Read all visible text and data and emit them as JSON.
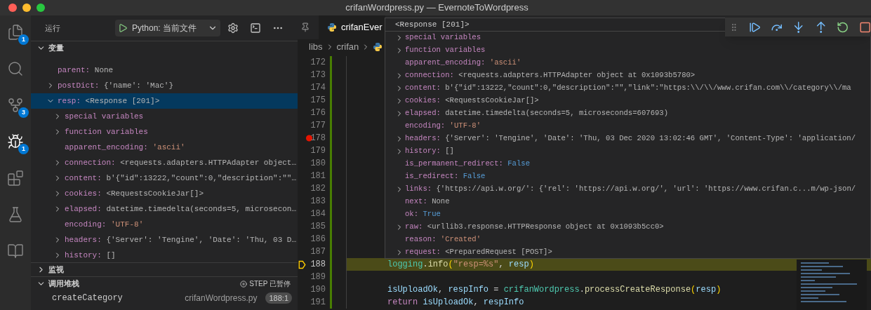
{
  "window": {
    "title": "crifanWordpress.py — EvernoteToWordpress"
  },
  "activity_bar": [
    {
      "kind": "files",
      "badge": "1",
      "selected": false
    },
    {
      "kind": "search",
      "selected": false
    },
    {
      "kind": "source-control",
      "badge": "3",
      "selected": false
    },
    {
      "kind": "debug",
      "badge": "1",
      "selected": true
    },
    {
      "kind": "extensions",
      "selected": false
    },
    {
      "kind": "testing",
      "selected": false
    },
    {
      "kind": "book",
      "selected": false
    }
  ],
  "run_header": {
    "title": "运行",
    "configuration": "Python: 当前文件"
  },
  "variables": {
    "title": "变量",
    "expanded": true,
    "items": [
      {
        "name": "parent:",
        "value": "None",
        "kind": "plain",
        "selected": false
      },
      {
        "name": "postDict:",
        "value": "{'name': 'Mac'}",
        "kind": "plain",
        "expanded": false,
        "selected": false
      },
      {
        "name": "resp:",
        "value": "<Response [201]>",
        "kind": "plain",
        "expanded": true,
        "selected": true,
        "children": [
          {
            "name": "special variables",
            "kind": "group",
            "expanded": false,
            "selected": false
          },
          {
            "name": "function variables",
            "kind": "group",
            "expanded": false,
            "selected": false
          },
          {
            "name": "apparent_encoding:",
            "value": "'ascii'",
            "kind": "string",
            "selected": false
          },
          {
            "name": "connection:",
            "value": "<requests.adapters.HTTPAdapter object…",
            "kind": "plain",
            "expanded": false,
            "selected": false
          },
          {
            "name": "content:",
            "value": "b'{\"id\":13222,\"count\":0,\"description\":\"\"…",
            "kind": "plain",
            "expanded": false,
            "selected": false
          },
          {
            "name": "cookies:",
            "value": "<RequestsCookieJar[]>",
            "kind": "plain",
            "expanded": false,
            "selected": false
          },
          {
            "name": "elapsed:",
            "value": "datetime.timedelta(seconds=5, microsecon…",
            "kind": "plain",
            "expanded": false,
            "selected": false
          },
          {
            "name": "encoding:",
            "value": "'UTF-8'",
            "kind": "string",
            "selected": false
          },
          {
            "name": "headers:",
            "value": "{'Server': 'Tengine', 'Date': 'Thu, 03 D…",
            "kind": "plain",
            "expanded": false,
            "selected": false
          },
          {
            "name": "history:",
            "value": "[]",
            "kind": "plain",
            "expanded": false,
            "selected": false
          }
        ]
      }
    ]
  },
  "watch": {
    "title": "监视",
    "expanded": false
  },
  "call_stack": {
    "title": "调用堆栈",
    "expanded": true,
    "status": "STEP 已暂停",
    "frames": [
      {
        "name": "createCategory",
        "file": "crifanWordpress.py",
        "position": "188:1",
        "selected": false
      }
    ]
  },
  "editor": {
    "tabs": [
      {
        "label": "crifanEver",
        "selected": true
      }
    ],
    "breadcrumb": [
      "libs",
      "crifan"
    ],
    "lines": [
      {
        "number": "172",
        "breakpoint": false,
        "current": false
      },
      {
        "number": "173",
        "breakpoint": false,
        "current": false
      },
      {
        "number": "174",
        "breakpoint": false,
        "current": false
      },
      {
        "number": "175",
        "breakpoint": false,
        "current": false
      },
      {
        "number": "176",
        "breakpoint": false,
        "current": false
      },
      {
        "number": "177",
        "breakpoint": false,
        "current": false
      },
      {
        "number": "178",
        "breakpoint": true,
        "current": false
      },
      {
        "number": "179",
        "breakpoint": false,
        "current": false
      },
      {
        "number": "180",
        "breakpoint": false,
        "current": false
      },
      {
        "number": "181",
        "breakpoint": false,
        "current": false
      },
      {
        "number": "182",
        "breakpoint": false,
        "current": false
      },
      {
        "number": "183",
        "breakpoint": false,
        "current": false
      },
      {
        "number": "184",
        "breakpoint": false,
        "current": false
      },
      {
        "number": "185",
        "breakpoint": false,
        "current": false
      },
      {
        "number": "186",
        "breakpoint": false,
        "current": false
      },
      {
        "number": "187",
        "breakpoint": false,
        "current": false
      },
      {
        "number": "188",
        "breakpoint": false,
        "current": true,
        "code": [
          {
            "text": "logging",
            "kind": "class"
          },
          {
            "text": ".",
            "kind": "plain"
          },
          {
            "text": "info",
            "kind": "func"
          },
          {
            "text": "(",
            "kind": "paren"
          },
          {
            "text": "\"resp=%s\"",
            "kind": "string"
          },
          {
            "text": ", ",
            "kind": "plain"
          },
          {
            "text": "resp",
            "kind": "var"
          },
          {
            "text": ")",
            "kind": "paren"
          }
        ]
      },
      {
        "number": "189",
        "breakpoint": false,
        "current": false
      },
      {
        "number": "190",
        "breakpoint": false,
        "current": false,
        "code": [
          {
            "text": "isUploadOk",
            "kind": "var"
          },
          {
            "text": ", ",
            "kind": "plain"
          },
          {
            "text": "respInfo",
            "kind": "var"
          },
          {
            "text": " = ",
            "kind": "plain"
          },
          {
            "text": "crifanWordpress",
            "kind": "class"
          },
          {
            "text": ".",
            "kind": "plain"
          },
          {
            "text": "processCreateResponse",
            "kind": "func"
          },
          {
            "text": "(",
            "kind": "paren"
          },
          {
            "text": "resp",
            "kind": "var"
          },
          {
            "text": ")",
            "kind": "paren"
          }
        ]
      },
      {
        "number": "191",
        "breakpoint": false,
        "current": false,
        "code": [
          {
            "text": "return ",
            "kind": "keyword"
          },
          {
            "text": "isUploadOk",
            "kind": "var"
          },
          {
            "text": ", ",
            "kind": "plain"
          },
          {
            "text": "respInfo",
            "kind": "var"
          }
        ]
      }
    ]
  },
  "hover": {
    "header": "<Response [201]>",
    "items": [
      {
        "name": "special variables",
        "kind": "group",
        "expanded": false
      },
      {
        "name": "function variables",
        "kind": "group",
        "expanded": false
      },
      {
        "name": "apparent_encoding:",
        "value": "'ascii'",
        "kind": "string"
      },
      {
        "name": "connection:",
        "value": "<requests.adapters.HTTPAdapter object at 0x1093b5780>",
        "kind": "plain",
        "expanded": false
      },
      {
        "name": "content:",
        "value": "b'{\"id\":13222,\"count\":0,\"description\":\"\",\"link\":\"https:\\\\/\\\\/www.crifan.com\\\\/category\\\\/ma",
        "kind": "plain",
        "expanded": false
      },
      {
        "name": "cookies:",
        "value": "<RequestsCookieJar[]>",
        "kind": "plain",
        "expanded": false
      },
      {
        "name": "elapsed:",
        "value": "datetime.timedelta(seconds=5, microseconds=607693)",
        "kind": "plain",
        "expanded": false
      },
      {
        "name": "encoding:",
        "value": "'UTF-8'",
        "kind": "string"
      },
      {
        "name": "headers:",
        "value": "{'Server': 'Tengine', 'Date': 'Thu, 03 Dec 2020 13:02:46 GMT', 'Content-Type': 'application/",
        "kind": "plain",
        "expanded": false
      },
      {
        "name": "history:",
        "value": "[]",
        "kind": "plain",
        "expanded": false
      },
      {
        "name": "is_permanent_redirect:",
        "value": "False",
        "kind": "bool"
      },
      {
        "name": "is_redirect:",
        "value": "False",
        "kind": "bool"
      },
      {
        "name": "links:",
        "value": "{'https://api.w.org/': {'rel': 'https://api.w.org/', 'url': 'https://www.crifan.c...m/wp-json/",
        "kind": "plain",
        "expanded": false
      },
      {
        "name": "next:",
        "value": "None",
        "kind": "plain"
      },
      {
        "name": "ok:",
        "value": "True",
        "kind": "bool"
      },
      {
        "name": "raw:",
        "value": "<urllib3.response.HTTPResponse object at 0x1093b5cc0>",
        "kind": "plain",
        "expanded": false
      },
      {
        "name": "reason:",
        "value": "'Created'",
        "kind": "string"
      },
      {
        "name": "request:",
        "value": "<PreparedRequest [POST]>",
        "kind": "plain",
        "expanded": false
      }
    ]
  },
  "debug_toolbar": [
    {
      "kind": "continue"
    },
    {
      "kind": "step-over"
    },
    {
      "kind": "step-into"
    },
    {
      "kind": "step-out"
    },
    {
      "kind": "restart"
    },
    {
      "kind": "stop"
    }
  ]
}
